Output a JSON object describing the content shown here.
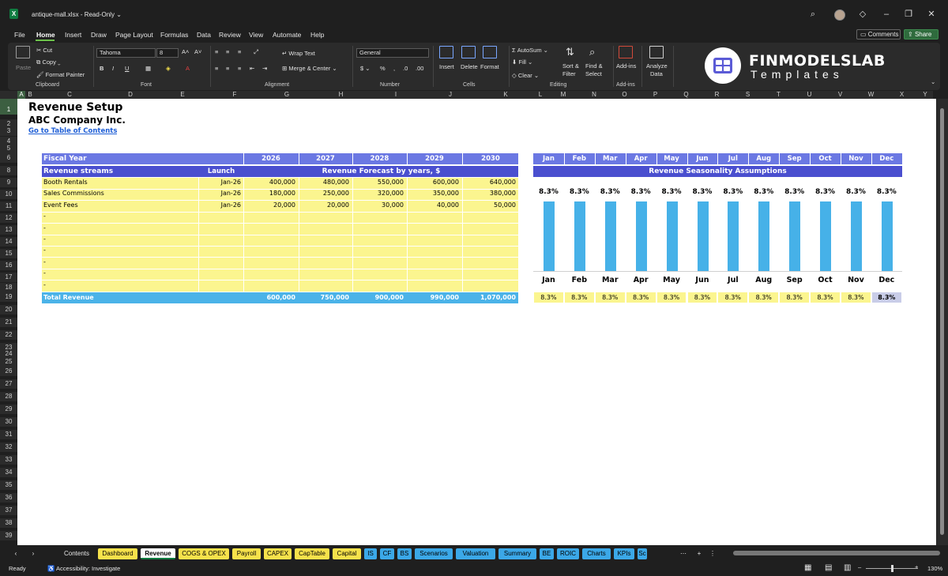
{
  "titlebar": {
    "filename": "antique-mall.xlsx",
    "mode": "Read-Only",
    "icons": [
      "search-icon",
      "diamond-icon",
      "minimize-icon",
      "restore-icon",
      "close-icon"
    ]
  },
  "menu": {
    "items": [
      "File",
      "Home",
      "Insert",
      "Draw",
      "Page Layout",
      "Formulas",
      "Data",
      "Review",
      "View",
      "Automate",
      "Help"
    ],
    "active": "Home",
    "comments": "Comments",
    "share": "Share"
  },
  "ribbon": {
    "paste": "Paste",
    "cut": "Cut",
    "copy": "Copy",
    "format_painter": "Format Painter",
    "clipboard": "Clipboard",
    "font_name": "Tahoma",
    "font_size": "8",
    "font": "Font",
    "wrap_text": "Wrap Text",
    "merge_center": "Merge & Center",
    "alignment": "Alignment",
    "number_format": "General",
    "number": "Number",
    "insert": "Insert",
    "delete": "Delete",
    "format": "Format",
    "cells": "Cells",
    "autosum": "AutoSum",
    "fill": "Fill",
    "clear": "Clear",
    "sort_filter": [
      "Sort &",
      "Filter"
    ],
    "find_select": [
      "Find &",
      "Select"
    ],
    "editing": "Editing",
    "addins": "Add-ins",
    "addins_group": "Add-ins",
    "analyze": [
      "Analyze",
      "Data"
    ],
    "logo_title": "FINMODELSLAB",
    "logo_sub": "Templates"
  },
  "columns": [
    "A",
    "B",
    "C",
    "D",
    "E",
    "F",
    "G",
    "H",
    "I",
    "J",
    "K",
    "L",
    "M",
    "N",
    "O",
    "P",
    "Q",
    "R",
    "S",
    "T",
    "U",
    "V",
    "W",
    "X",
    "Y"
  ],
  "rows": [
    "1",
    "2",
    "3",
    "4",
    "5",
    "6",
    "8",
    "9",
    "10",
    "11",
    "12",
    "13",
    "14",
    "15",
    "16",
    "17",
    "18",
    "19",
    "20",
    "21",
    "22",
    "23",
    "24",
    "25",
    "26",
    "27",
    "28",
    "29",
    "30",
    "31",
    "32",
    "33",
    "34",
    "35",
    "36",
    "37",
    "38",
    "39"
  ],
  "sheet": {
    "title": "Revenue Setup",
    "company": "ABC Company Inc.",
    "toc_link": "Go to Table of Contents",
    "fiscal_year_label": "Fiscal Year",
    "years": [
      "2026",
      "2027",
      "2028",
      "2029",
      "2030"
    ],
    "streams_label": "Revenue streams",
    "launch_label": "Launch",
    "forecast_label": "Revenue Forecast by years, $",
    "streams": [
      {
        "name": "Booth Rentals",
        "launch": "Jan-26",
        "values": [
          "400,000",
          "480,000",
          "550,000",
          "600,000",
          "640,000"
        ]
      },
      {
        "name": "Sales Commissions",
        "launch": "Jan-26",
        "values": [
          "180,000",
          "250,000",
          "320,000",
          "350,000",
          "380,000"
        ]
      },
      {
        "name": "Event Fees",
        "launch": "Jan-26",
        "values": [
          "20,000",
          "20,000",
          "30,000",
          "40,000",
          "50,000"
        ]
      },
      {
        "name": "-",
        "launch": "",
        "values": [
          "",
          "",
          "",
          "",
          ""
        ]
      },
      {
        "name": "-",
        "launch": "",
        "values": [
          "",
          "",
          "",
          "",
          ""
        ]
      },
      {
        "name": "-",
        "launch": "",
        "values": [
          "",
          "",
          "",
          "",
          ""
        ]
      },
      {
        "name": "-",
        "launch": "",
        "values": [
          "",
          "",
          "",
          "",
          ""
        ]
      },
      {
        "name": "-",
        "launch": "",
        "values": [
          "",
          "",
          "",
          "",
          ""
        ]
      },
      {
        "name": "-",
        "launch": "",
        "values": [
          "",
          "",
          "",
          "",
          ""
        ]
      },
      {
        "name": "-",
        "launch": "",
        "values": [
          "",
          "",
          "",
          "",
          ""
        ]
      }
    ],
    "total_label": "Total Revenue",
    "totals": [
      "600,000",
      "750,000",
      "900,000",
      "990,000",
      "1,070,000"
    ],
    "months": [
      "Jan",
      "Feb",
      "Mar",
      "Apr",
      "May",
      "Jun",
      "Jul",
      "Aug",
      "Sep",
      "Oct",
      "Nov",
      "Dec"
    ],
    "seasonality_label": "Revenue Seasonality Assumptions",
    "seasonality_values": [
      "8.3%",
      "8.3%",
      "8.3%",
      "8.3%",
      "8.3%",
      "8.3%",
      "8.3%",
      "8.3%",
      "8.3%",
      "8.3%",
      "8.3%",
      "8.3%"
    ]
  },
  "chart_data": {
    "type": "bar",
    "categories": [
      "Jan",
      "Feb",
      "Mar",
      "Apr",
      "May",
      "Jun",
      "Jul",
      "Aug",
      "Sep",
      "Oct",
      "Nov",
      "Dec"
    ],
    "values": [
      8.3,
      8.3,
      8.3,
      8.3,
      8.3,
      8.3,
      8.3,
      8.3,
      8.3,
      8.3,
      8.3,
      8.3
    ],
    "data_labels": [
      "8.3%",
      "8.3%",
      "8.3%",
      "8.3%",
      "8.3%",
      "8.3%",
      "8.3%",
      "8.3%",
      "8.3%",
      "8.3%",
      "8.3%",
      "8.3%"
    ],
    "ylim": [
      0,
      9
    ],
    "grid": false,
    "bar_color": "#46b1e8"
  },
  "tabs": [
    {
      "label": "Contents",
      "style": "n"
    },
    {
      "label": "Dashboard",
      "style": "y"
    },
    {
      "label": "Revenue",
      "style": "active"
    },
    {
      "label": "COGS & OPEX",
      "style": "y"
    },
    {
      "label": "Payroll",
      "style": "y"
    },
    {
      "label": "CAPEX",
      "style": "y"
    },
    {
      "label": "CapTable",
      "style": "y"
    },
    {
      "label": "Capital",
      "style": "y"
    },
    {
      "label": "IS",
      "style": "b"
    },
    {
      "label": "CF",
      "style": "b"
    },
    {
      "label": "BS",
      "style": "b"
    },
    {
      "label": "Scenarios",
      "style": "b"
    },
    {
      "label": "Valuation",
      "style": "b"
    },
    {
      "label": "Summary",
      "style": "b"
    },
    {
      "label": "BE",
      "style": "b"
    },
    {
      "label": "ROIC",
      "style": "b"
    },
    {
      "label": "Charts",
      "style": "b"
    },
    {
      "label": "KPIs",
      "style": "b"
    },
    {
      "label": "Sc",
      "style": "b"
    }
  ],
  "status": {
    "ready": "Ready",
    "accessibility": "Accessibility: Investigate",
    "zoom": "130%"
  },
  "colors": {
    "header_band": "#6b78e3",
    "header_band_dark": "#4a4fcf",
    "input_yellow": "#fbf58f",
    "total_blue": "#4bb3e8",
    "accent_green": "#107c41"
  }
}
